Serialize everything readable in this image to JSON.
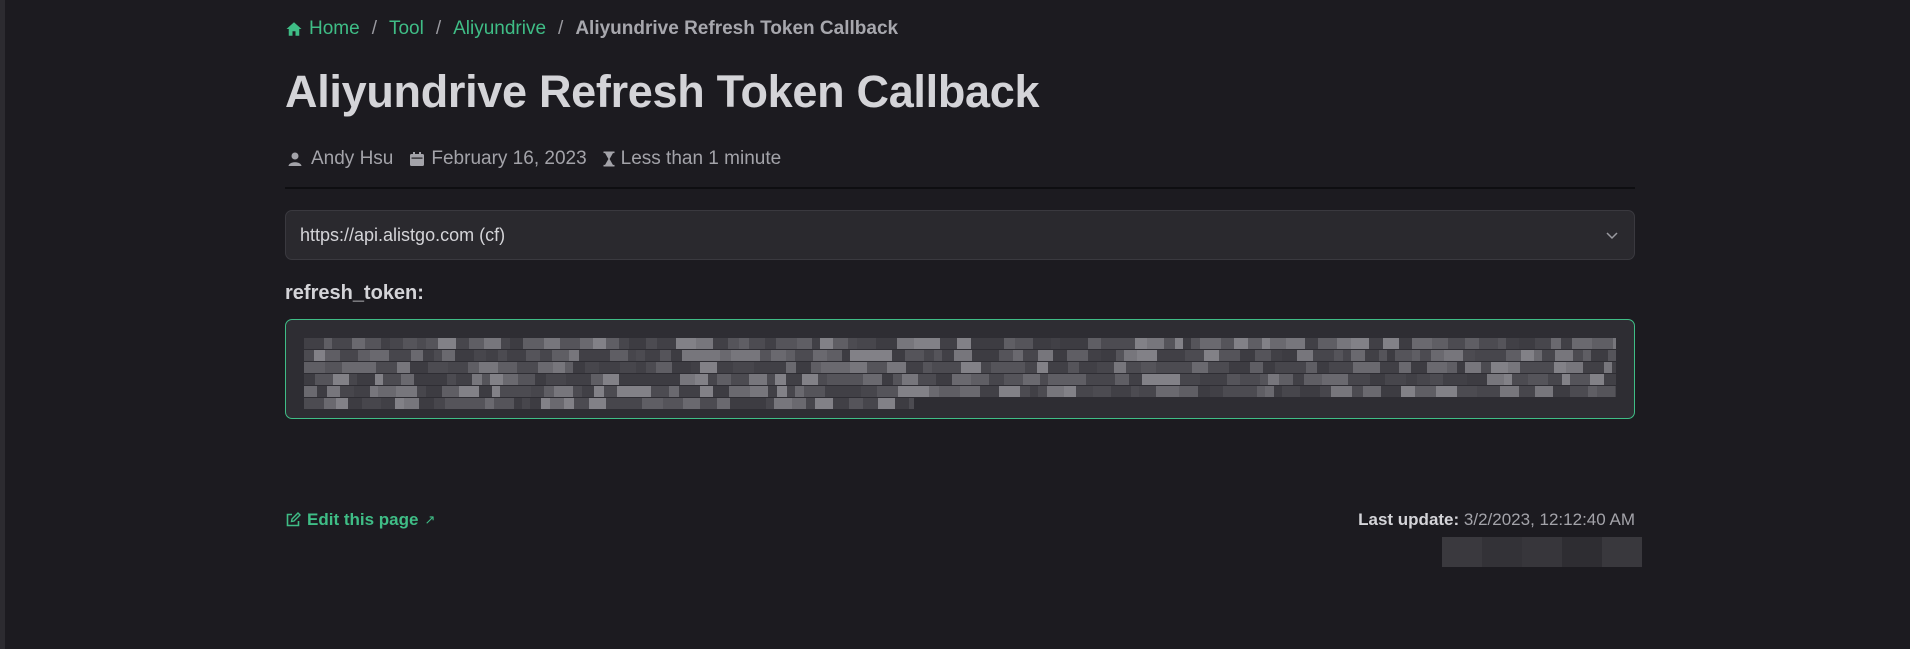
{
  "breadcrumb": {
    "items": [
      "Home",
      "Tool",
      "Aliyundrive"
    ],
    "separator": "/",
    "current": "Aliyundrive Refresh Token Callback"
  },
  "page": {
    "title": "Aliyundrive Refresh Token Callback"
  },
  "meta": {
    "author": "Andy Hsu",
    "date": "February 16, 2023",
    "reading_time": "Less than 1 minute"
  },
  "api_select": {
    "selected": "https://api.alistgo.com (cf)"
  },
  "token_field": {
    "label": "refresh_token:"
  },
  "footer": {
    "edit_label": "Edit this page",
    "edit_arrow": "↗",
    "last_update_label": "Last update:",
    "last_update_value": "3/2/2023, 12:12:40 AM"
  },
  "colors": {
    "accent": "#3fbd86",
    "background": "#1c1b20",
    "surface": "#2a292e"
  },
  "icons": {
    "home": "home-icon",
    "author": "user-icon",
    "date": "calendar-icon",
    "reading_time": "hourglass-icon",
    "select": "chevron-down-icon",
    "edit": "edit-icon"
  }
}
